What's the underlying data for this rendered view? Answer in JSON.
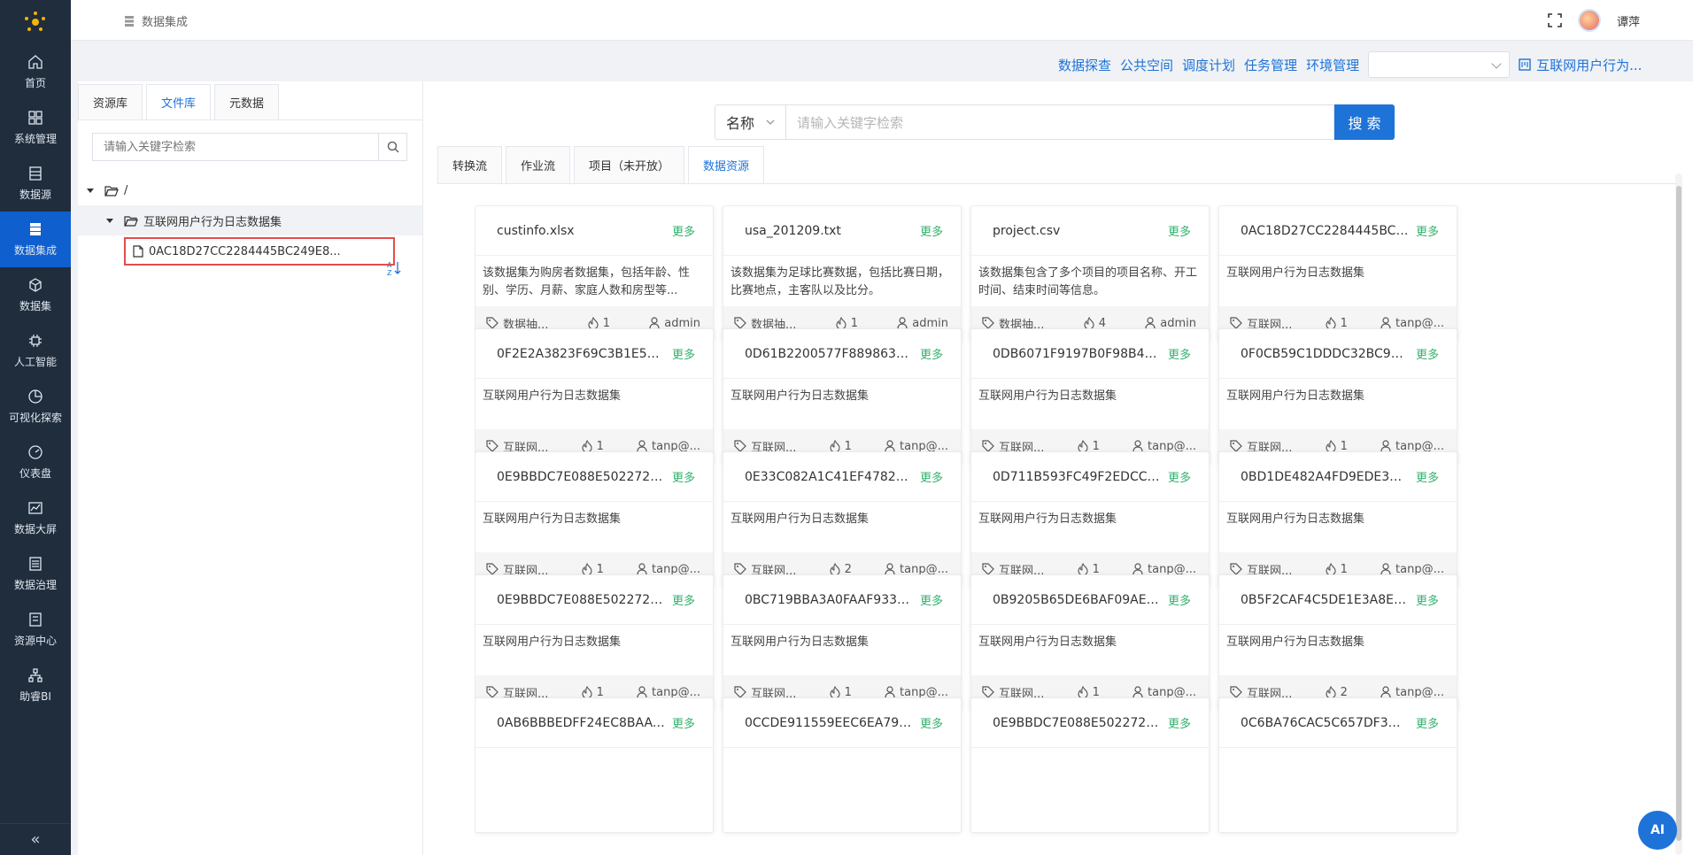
{
  "sidebar": {
    "items": [
      {
        "label": "首页",
        "icon": "home-icon"
      },
      {
        "label": "系统管理",
        "icon": "grid-icon"
      },
      {
        "label": "数据源",
        "icon": "database-icon"
      },
      {
        "label": "数据集成",
        "icon": "stack-icon",
        "active": true
      },
      {
        "label": "数据集",
        "icon": "cube-icon"
      },
      {
        "label": "人工智能",
        "icon": "ai-icon"
      },
      {
        "label": "可视化探索",
        "icon": "pie-icon"
      },
      {
        "label": "仪表盘",
        "icon": "gauge-icon"
      },
      {
        "label": "数据大屏",
        "icon": "chart-icon"
      },
      {
        "label": "数据治理",
        "icon": "list-icon"
      },
      {
        "label": "资源中心",
        "icon": "folder-icon"
      },
      {
        "label": "助睿BI",
        "icon": "org-icon"
      }
    ],
    "collapse": "«"
  },
  "header": {
    "breadcrumb": "数据集成",
    "user": "谭萍"
  },
  "submenu": {
    "links": [
      "数据探查",
      "公共空间",
      "调度计划",
      "任务管理",
      "环境管理"
    ],
    "select_value": "",
    "flow_label": "互联网用户行为..."
  },
  "filepanel": {
    "tabs": [
      "资源库",
      "文件库",
      "元数据"
    ],
    "active_tab": 1,
    "search_placeholder": "请输入关键字检索",
    "root": "/",
    "folder": "互联网用户行为日志数据集",
    "file": "0AC18D27CC2284445BC249E8..."
  },
  "main": {
    "search_field": "名称",
    "search_placeholder": "请输入关键字检索",
    "search_button": "搜 索",
    "tabs": [
      "转换流",
      "作业流",
      "项目（未开放）",
      "数据资源"
    ],
    "active_tab": 3,
    "more_label": "更多",
    "cards": [
      {
        "title": "custinfo.xlsx",
        "desc": "该数据集为购房者数据集，包括年龄、性别、学历、月薪、家庭人数和房型等...",
        "tag": "数据抽...",
        "likes": "1",
        "user": "admin"
      },
      {
        "title": "usa_201209.txt",
        "desc": "该数据集为足球比赛数据，包括比赛日期，比赛地点，主客队以及比分。",
        "tag": "数据抽...",
        "likes": "1",
        "user": "admin"
      },
      {
        "title": "project.csv",
        "desc": "该数据集包含了多个项目的项目名称、开工时间、结束时间等信息。",
        "tag": "数据抽...",
        "likes": "4",
        "user": "admin"
      },
      {
        "title": "0AC18D27CC2284445BC2...",
        "desc": "互联网用户行为日志数据集",
        "tag": "互联网...",
        "likes": "1",
        "user": "tanp@..."
      },
      {
        "title": "0F2E2A3823F69C3B1E5CD...",
        "desc": "互联网用户行为日志数据集",
        "tag": "互联网...",
        "likes": "1",
        "user": "tanp@..."
      },
      {
        "title": "0D61B2200577F889863F8...",
        "desc": "互联网用户行为日志数据集",
        "tag": "互联网...",
        "likes": "1",
        "user": "tanp@..."
      },
      {
        "title": "0DB6071F9197B0F98B415...",
        "desc": "互联网用户行为日志数据集",
        "tag": "互联网...",
        "likes": "1",
        "user": "tanp@..."
      },
      {
        "title": "0F0CB59C1DDDC32BC910...",
        "desc": "互联网用户行为日志数据集",
        "tag": "互联网...",
        "likes": "1",
        "user": "tanp@..."
      },
      {
        "title": "0E9BBDC7E088E50227216...",
        "desc": "互联网用户行为日志数据集",
        "tag": "互联网...",
        "likes": "1",
        "user": "tanp@..."
      },
      {
        "title": "0E33C082A1C41EF4782D8...",
        "desc": "互联网用户行为日志数据集",
        "tag": "互联网...",
        "likes": "2",
        "user": "tanp@..."
      },
      {
        "title": "0D711B593FC49F2EDCC47...",
        "desc": "互联网用户行为日志数据集",
        "tag": "互联网...",
        "likes": "1",
        "user": "tanp@..."
      },
      {
        "title": "0BD1DE482A4FD9EDE319...",
        "desc": "互联网用户行为日志数据集",
        "tag": "互联网...",
        "likes": "1",
        "user": "tanp@..."
      },
      {
        "title": "0E9BBDC7E088E50227216...",
        "desc": "互联网用户行为日志数据集",
        "tag": "互联网...",
        "likes": "1",
        "user": "tanp@..."
      },
      {
        "title": "0BC719BBA3A0FAAF9339...",
        "desc": "互联网用户行为日志数据集",
        "tag": "互联网...",
        "likes": "1",
        "user": "tanp@..."
      },
      {
        "title": "0B9205B65DE6BAF09AE4...",
        "desc": "互联网用户行为日志数据集",
        "tag": "互联网...",
        "likes": "1",
        "user": "tanp@..."
      },
      {
        "title": "0B5F2CAF4C5DE1E3A8E68...",
        "desc": "互联网用户行为日志数据集",
        "tag": "互联网...",
        "likes": "2",
        "user": "tanp@..."
      },
      {
        "title": "0AB6BBBEDFF24EC8BAAC...",
        "desc": "",
        "tag": "",
        "likes": "",
        "user": ""
      },
      {
        "title": "0CCDE911559EEC6EA7915...",
        "desc": "",
        "tag": "",
        "likes": "",
        "user": ""
      },
      {
        "title": "0E9BBDC7E088E50227216...",
        "desc": "",
        "tag": "",
        "likes": "",
        "user": ""
      },
      {
        "title": "0C6BA76CAC5C657DF3A0...",
        "desc": "",
        "tag": "",
        "likes": "",
        "user": ""
      }
    ]
  },
  "ai_button": "AI",
  "colors": {
    "sidebar": "#1f2d3d",
    "accent": "#1e73d8",
    "more": "#32b16c"
  }
}
